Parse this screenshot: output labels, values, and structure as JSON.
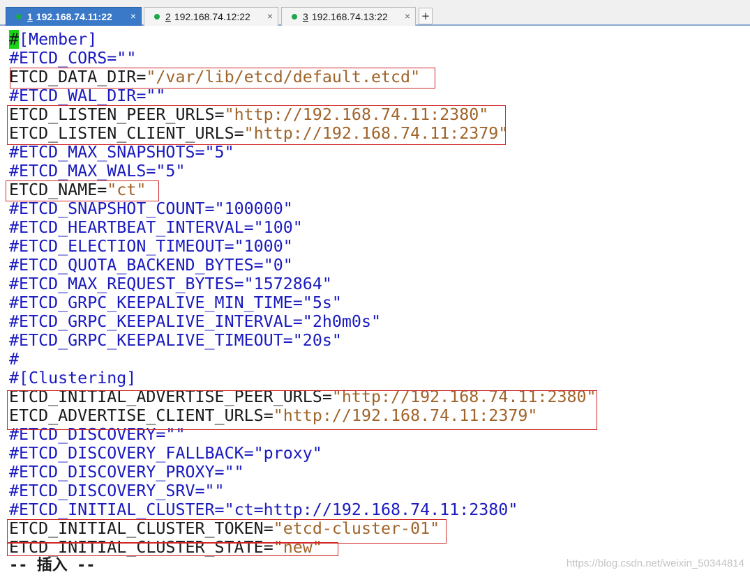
{
  "tabs": [
    {
      "num": "1",
      "host": "192.168.74.11:22",
      "close": "×",
      "active": true
    },
    {
      "num": "2",
      "host": "192.168.74.12:22",
      "close": "×",
      "active": false
    },
    {
      "num": "3",
      "host": "192.168.74.13:22",
      "close": "×",
      "active": false
    }
  ],
  "new_tab_label": "+",
  "lines": [
    {
      "cursor": "#",
      "key": "[Member]",
      "eq": "",
      "val": ""
    },
    {
      "key": "#ETCD_CORS",
      "eq": "=",
      "val": "\"\""
    },
    {
      "key": "ETCD_DATA_DIR",
      "eq": "=",
      "val": "\"/var/lib/etcd/default.etcd\""
    },
    {
      "key": "#ETCD_WAL_DIR",
      "eq": "=",
      "val": "\"\""
    },
    {
      "key": "ETCD_LISTEN_PEER_URLS",
      "eq": "=",
      "val": "\"http://192.168.74.11:2380\""
    },
    {
      "key": "ETCD_LISTEN_CLIENT_URLS",
      "eq": "=",
      "val": "\"http://192.168.74.11:2379\""
    },
    {
      "key": "#ETCD_MAX_SNAPSHOTS",
      "eq": "=",
      "val": "\"5\""
    },
    {
      "key": "#ETCD_MAX_WALS",
      "eq": "=",
      "val": "\"5\""
    },
    {
      "key": "ETCD_NAME",
      "eq": "=",
      "val": "\"ct\""
    },
    {
      "key": "#ETCD_SNAPSHOT_COUNT",
      "eq": "=",
      "val": "\"100000\""
    },
    {
      "key": "#ETCD_HEARTBEAT_INTERVAL",
      "eq": "=",
      "val": "\"100\""
    },
    {
      "key": "#ETCD_ELECTION_TIMEOUT",
      "eq": "=",
      "val": "\"1000\""
    },
    {
      "key": "#ETCD_QUOTA_BACKEND_BYTES",
      "eq": "=",
      "val": "\"0\""
    },
    {
      "key": "#ETCD_MAX_REQUEST_BYTES",
      "eq": "=",
      "val": "\"1572864\""
    },
    {
      "key": "#ETCD_GRPC_KEEPALIVE_MIN_TIME",
      "eq": "=",
      "val": "\"5s\""
    },
    {
      "key": "#ETCD_GRPC_KEEPALIVE_INTERVAL",
      "eq": "=",
      "val": "\"2h0m0s\""
    },
    {
      "key": "#ETCD_GRPC_KEEPALIVE_TIMEOUT",
      "eq": "=",
      "val": "\"20s\""
    },
    {
      "key": "#",
      "eq": "",
      "val": ""
    },
    {
      "key": "#[Clustering]",
      "eq": "",
      "val": ""
    },
    {
      "key": "ETCD_INITIAL_ADVERTISE_PEER_URLS",
      "eq": "=",
      "val": "\"http://192.168.74.11:2380\""
    },
    {
      "key": "ETCD_ADVERTISE_CLIENT_URLS",
      "eq": "=",
      "val": "\"http://192.168.74.11:2379\""
    },
    {
      "key": "#ETCD_DISCOVERY",
      "eq": "=",
      "val": "\"\""
    },
    {
      "key": "#ETCD_DISCOVERY_FALLBACK",
      "eq": "=",
      "val": "\"proxy\""
    },
    {
      "key": "#ETCD_DISCOVERY_PROXY",
      "eq": "=",
      "val": "\"\""
    },
    {
      "key": "#ETCD_DISCOVERY_SRV",
      "eq": "=",
      "val": "\"\""
    },
    {
      "key": "#ETCD_INITIAL_CLUSTER",
      "eq": "=",
      "val": "\"ct=http://192.168.74.11:2380\""
    },
    {
      "key": "ETCD_INITIAL_CLUSTER_TOKEN",
      "eq": "=",
      "val": "\"etcd-cluster-01\""
    },
    {
      "key": "ETCD_INITIAL_CLUSTER_STATE",
      "eq": "=",
      "val": "\"new\""
    }
  ],
  "mode_line": "-- 插入 --",
  "watermark": "https://blog.csdn.net/weixin_50344814",
  "colors": {
    "comment": "#1a1ac0",
    "active_key": "#1a1a1a",
    "string": "#a0642a",
    "highlight_box": "#d02828",
    "cursor": "#17d417",
    "active_tab": "#3a78c8",
    "status_dot": "#1da84a"
  }
}
